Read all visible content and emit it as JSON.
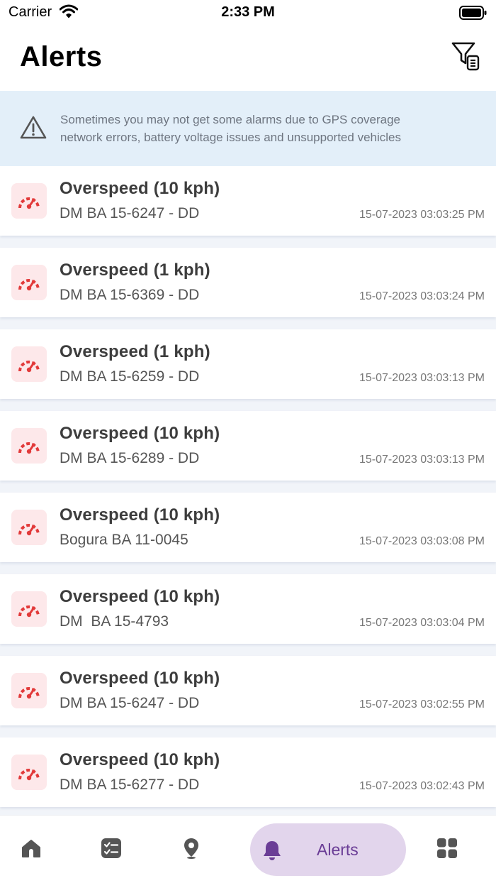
{
  "status_bar": {
    "carrier": "Carrier",
    "time": "2:33 PM"
  },
  "header": {
    "title": "Alerts",
    "filter_icon": "filter-list-icon"
  },
  "notice": {
    "icon": "warning-icon",
    "line1": "Sometimes you may not get some alarms due to GPS coverage",
    "line2": "network errors, battery voltage issues and unsupported vehicles"
  },
  "colors": {
    "accent": "#6a3d96",
    "accent_bg": "#e2d5ec",
    "alert_red": "#e23a3a",
    "alert_icon_bg": "#fde8ea",
    "notice_bg": "#e3eff9"
  },
  "alerts": [
    {
      "title": "Overspeed (10 kph)",
      "vehicle": "DM BA 15-6247 - DD",
      "time": "15-07-2023 03:03:25 PM"
    },
    {
      "title": "Overspeed (1 kph)",
      "vehicle": "DM BA 15-6369 - DD",
      "time": "15-07-2023 03:03:24 PM"
    },
    {
      "title": "Overspeed (1 kph)",
      "vehicle": "DM BA 15-6259 - DD",
      "time": "15-07-2023 03:03:13 PM"
    },
    {
      "title": "Overspeed (10 kph)",
      "vehicle": "DM BA 15-6289 - DD",
      "time": "15-07-2023 03:03:13 PM"
    },
    {
      "title": "Overspeed (10 kph)",
      "vehicle": "Bogura BA 11-0045",
      "time": "15-07-2023 03:03:08 PM"
    },
    {
      "title": "Overspeed (10 kph)",
      "vehicle": "DM  BA 15-4793",
      "time": "15-07-2023 03:03:04 PM"
    },
    {
      "title": "Overspeed (10 kph)",
      "vehicle": "DM BA 15-6247 - DD",
      "time": "15-07-2023 03:02:55 PM"
    },
    {
      "title": "Overspeed (10 kph)",
      "vehicle": "DM BA 15-6277 - DD",
      "time": "15-07-2023 03:02:43 PM"
    }
  ],
  "bottom_nav": {
    "items": [
      {
        "icon": "home-icon"
      },
      {
        "icon": "checklist-icon"
      },
      {
        "icon": "location-pin-icon"
      },
      {
        "icon": "bell-icon",
        "label": "Alerts",
        "active": true
      },
      {
        "icon": "grid-menu-icon"
      }
    ]
  }
}
